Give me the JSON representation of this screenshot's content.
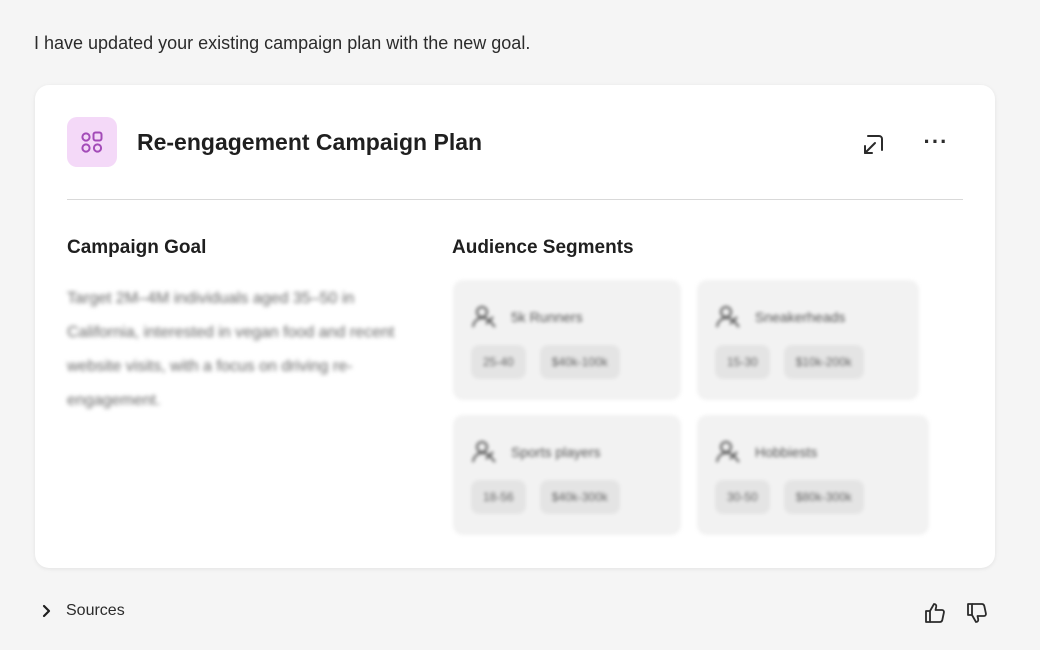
{
  "message": {
    "text": "I have updated your existing campaign plan with the new goal."
  },
  "card": {
    "title": "Re-engagement Campaign Plan",
    "app_icon": "segments-app-icon",
    "actions": {
      "open_icon": "open-in-new-icon",
      "more_label": "···"
    },
    "goal": {
      "title": "Campaign Goal",
      "text": "Target 2M–4M individuals aged 35–50 in California, interested in vegan food and recent website visits, with a focus on driving re-engagement."
    },
    "audience": {
      "title": "Audience Segments",
      "segments": [
        {
          "name": "5k Runners",
          "age": "25-40",
          "income": "$40k-100k"
        },
        {
          "name": "Sneakerheads",
          "age": "15-30",
          "income": "$10k-200k"
        },
        {
          "name": "Sports players",
          "age": "18-56",
          "income": "$40k-300k"
        },
        {
          "name": "Hobbiests",
          "age": "30-50",
          "income": "$80k-300k"
        }
      ]
    }
  },
  "footer": {
    "sources_label": "Sources",
    "thumbs_up_icon": "thumbs-up-icon",
    "thumbs_down_icon": "thumbs-down-icon"
  },
  "colors": {
    "app_icon_bg": "#f4d9f8",
    "app_icon_fg": "#a34bb8",
    "background": "#f5f5f5"
  }
}
